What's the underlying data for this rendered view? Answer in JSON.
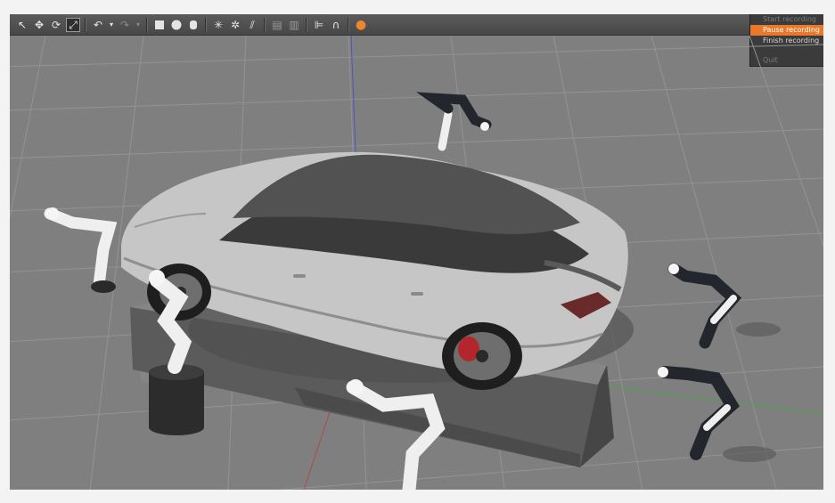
{
  "toolbar": {
    "icons": [
      "select-arrow-icon",
      "translate-icon",
      "rotate-icon",
      "scale-icon",
      "undo-icon",
      "undo-history-icon",
      "redo-icon",
      "redo-history-icon",
      "box-shape-icon",
      "sphere-shape-icon",
      "cylinder-shape-icon",
      "point-light-icon",
      "spot-light-icon",
      "directional-light-icon",
      "copy-icon",
      "paste-icon",
      "align-icon",
      "snap-icon",
      "record-icon"
    ]
  },
  "menu": {
    "items": [
      {
        "label": "Start recording",
        "state": "disabled"
      },
      {
        "label": "Pause recording",
        "state": "highlighted"
      },
      {
        "label": "Finish recording",
        "state": "normal"
      },
      {
        "label": "Quit",
        "state": "disabled"
      }
    ],
    "highlight_color": "#e9782b"
  },
  "scene": {
    "background_color": "#7f7f7f",
    "grid_color": "#8f8f8f",
    "car_color": "#c9c9c9",
    "roof_color": "#555555",
    "rim_accent": "#b3262b",
    "arm_white": "#efefef",
    "arm_dark": "#23262c"
  }
}
